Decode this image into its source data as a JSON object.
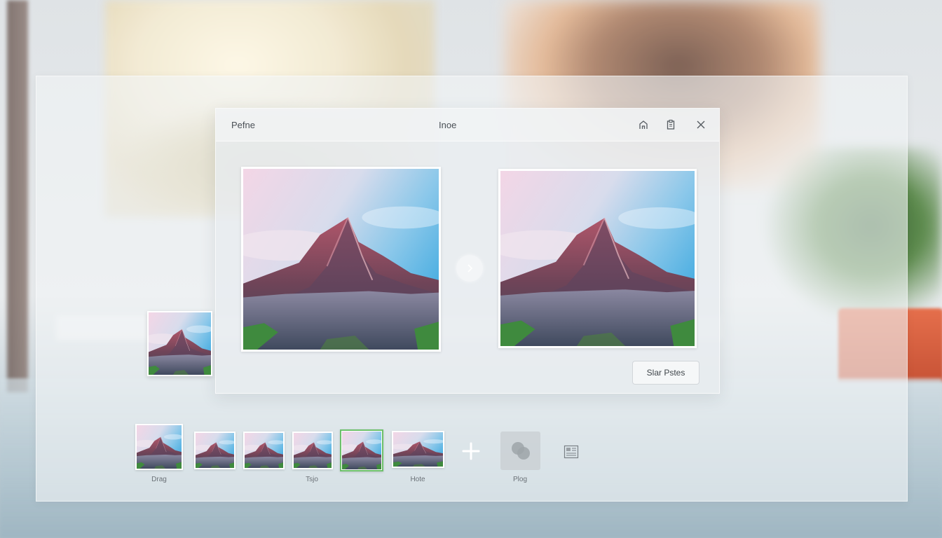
{
  "dialog": {
    "title_left": "Pefne",
    "title_center": "Inoe",
    "header_icons": [
      "home-icon",
      "clipboard-icon",
      "close-icon"
    ],
    "action_button_label": "Slar Pstes"
  },
  "filmstrip": {
    "labels": {
      "first": "Drag",
      "middle": "Tsjo",
      "sixth": "Hote",
      "tool": "Plog"
    },
    "selected_index": 4,
    "thumbnail_count": 6
  },
  "icons": {
    "next": "chevron-right-icon",
    "add": "plus-icon",
    "tool": "overlap-circles-icon",
    "layout": "layout-icon"
  },
  "colors": {
    "selection_accent": "#6cc06a",
    "sky_top": "#f2d4e2",
    "sky_right": "#5db4e0",
    "rock": "#9c4b5a"
  }
}
